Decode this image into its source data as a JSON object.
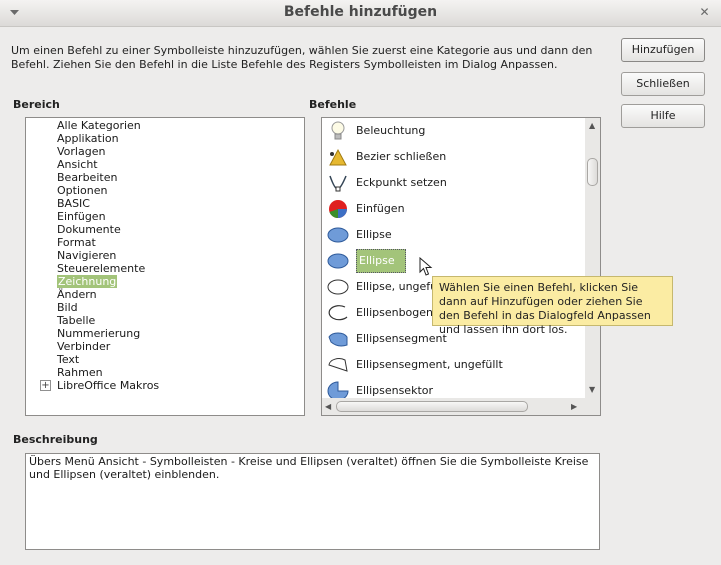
{
  "window": {
    "title": "Befehle hinzufügen",
    "close_glyph": "✕"
  },
  "intro": "Um einen Befehl zu einer Symbolleiste hinzuzufügen, wählen Sie zuerst eine Kategorie aus und dann den Befehl. Ziehen Sie den Befehl in die Liste Befehle des Registers Symbolleisten im Dialog Anpassen.",
  "buttons": {
    "add": "Hinzufügen",
    "close": "Schließen",
    "help": "Hilfe"
  },
  "bereich": {
    "label": "Bereich",
    "items": [
      "Alle Kategorien",
      "Applikation",
      "Vorlagen",
      "Ansicht",
      "Bearbeiten",
      "Optionen",
      "BASIC",
      "Einfügen",
      "Dokumente",
      "Format",
      "Navigieren",
      "Steuerelemente",
      "Zeichnung",
      "Ändern",
      "Bild",
      "Tabelle",
      "Nummerierung",
      "Verbinder",
      "Text",
      "Rahmen",
      "LibreOffice Makros"
    ],
    "selected_index": 12,
    "expander_glyph": "+"
  },
  "befehle": {
    "label": "Befehle",
    "items": [
      {
        "label": "Beleuchtung",
        "icon": "lightbulb-icon"
      },
      {
        "label": "Bezier schließen",
        "icon": "bezier-close-icon"
      },
      {
        "label": "Eckpunkt setzen",
        "icon": "corner-point-icon"
      },
      {
        "label": "Einfügen",
        "icon": "insert-chart-icon"
      },
      {
        "label": "Ellipse",
        "icon": "ellipse-filled-icon"
      },
      {
        "label": "Ellipse",
        "icon": "ellipse-filled-icon"
      },
      {
        "label": "Ellipse, ungefüllt",
        "icon": "ellipse-outline-icon"
      },
      {
        "label": "Ellipsenbogen",
        "icon": "ellipse-arc-icon"
      },
      {
        "label": "Ellipsensegment",
        "icon": "ellipse-segment-icon"
      },
      {
        "label": "Ellipsensegment, ungefüllt",
        "icon": "ellipse-segment-outline-icon"
      },
      {
        "label": "Ellipsensektor",
        "icon": "ellipse-sector-icon"
      }
    ],
    "selected_index": 5
  },
  "tooltip": "Wählen Sie einen Befehl, klicken Sie dann auf Hinzufügen oder ziehen Sie den Befehl in das Dialogfeld Anpassen und lassen ihn dort los.",
  "beschreibung": {
    "label": "Beschreibung",
    "text": "Übers Menü Ansicht - Symbolleisten - Kreise und Ellipsen (veraltet) öffnen Sie die Symbolleiste Kreise und Ellipsen (veraltet) einblenden."
  },
  "colors": {
    "selection": "#a3c47a",
    "tooltip_bg": "#fbeca3",
    "ellipse_blue": "#6f9bd8"
  }
}
